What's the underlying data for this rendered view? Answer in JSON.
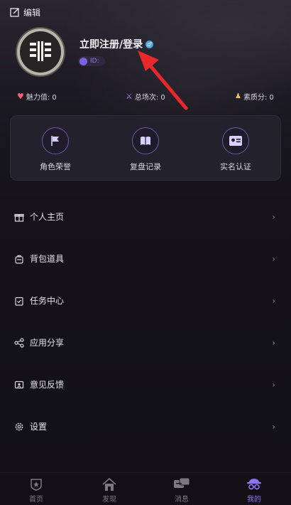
{
  "header": {
    "edit_label": "编辑"
  },
  "profile": {
    "login_label": "立即注册/登录",
    "id_label": "ID:"
  },
  "stats": {
    "charm": "魅力值: 0",
    "matches": "总场次: 0",
    "quality": "素质分: 0"
  },
  "quick_actions": [
    {
      "label": "角色荣誉",
      "icon": "flag-icon"
    },
    {
      "label": "复盘记录",
      "icon": "book-icon"
    },
    {
      "label": "实名认证",
      "icon": "id-card-icon"
    }
  ],
  "menu": [
    {
      "label": "个人主页",
      "icon": "gift-icon"
    },
    {
      "label": "背包道具",
      "icon": "backpack-icon"
    },
    {
      "label": "任务中心",
      "icon": "clipboard-check-icon"
    },
    {
      "label": "应用分享",
      "icon": "share-icon"
    },
    {
      "label": "意见反馈",
      "icon": "feedback-icon"
    },
    {
      "label": "设置",
      "icon": "gear-icon"
    }
  ],
  "tabbar": [
    {
      "label": "首页",
      "icon": "home-badge-icon",
      "active": false
    },
    {
      "label": "发现",
      "icon": "house-icon",
      "active": false
    },
    {
      "label": "消息",
      "icon": "message-icon",
      "active": false
    },
    {
      "label": "我的",
      "icon": "detective-icon",
      "active": true
    }
  ],
  "colors": {
    "accent": "#8b73ff",
    "annotation_arrow": "#e8282a"
  }
}
